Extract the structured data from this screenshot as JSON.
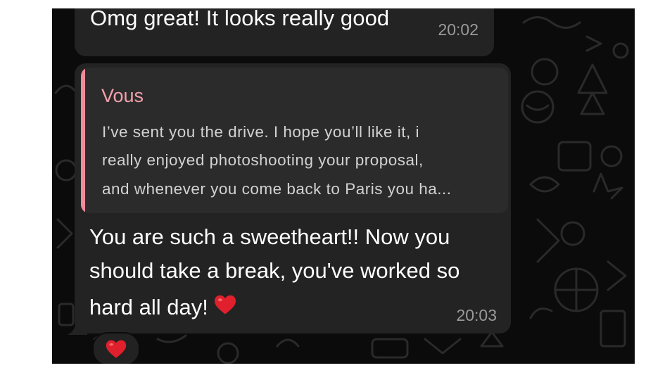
{
  "messages": [
    {
      "text": "Omg great! It looks really good",
      "time": "20:02"
    },
    {
      "reply_to": {
        "author": "Vous",
        "lines": [
          "I’ve sent you the drive. I hope you’ll like it, i",
          "really enjoyed photoshooting your proposal,",
          "and whenever you come back to Paris you ha..."
        ]
      },
      "lines": [
        "You are such a sweetheart!! Now you",
        "should take a break, you've worked so",
        "hard all day!"
      ],
      "time": "20:03",
      "reaction": "heart"
    }
  ],
  "colors": {
    "background": "#0b0b0b",
    "bubble": "#232323",
    "quote_bar": "#f08a9a",
    "quote_author": "#f2a0ac",
    "timestamp": "#9a9a9a",
    "heart": "#e0202c"
  },
  "icons": [
    "heart-emoji-icon",
    "heart-reaction-icon"
  ]
}
